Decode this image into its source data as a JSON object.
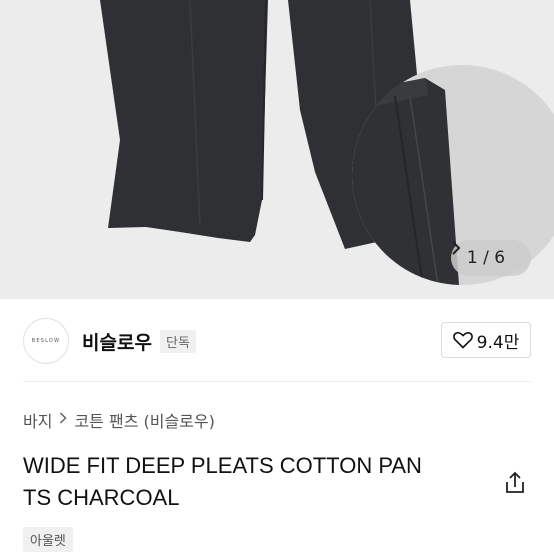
{
  "gallery": {
    "current": "1",
    "total": "6",
    "counter_text": "1 / 6",
    "next_icon": "chevron-right-icon"
  },
  "brand": {
    "logo_text": "BESLOW",
    "name": "비슬로우",
    "badge": "단독",
    "like_count": "9.4만",
    "like_icon": "heart-outline-icon"
  },
  "breadcrumb": {
    "category": "바지",
    "subcategory": "코튼 팬츠 (비슬로우)",
    "separator_icon": "chevron-right-icon"
  },
  "product": {
    "title_line1": "WIDE FIT DEEP PLEATS COTTON PAN",
    "title_line2": "TS CHARCOAL",
    "tag": "아울렛",
    "share_icon": "share-icon"
  },
  "colors": {
    "pants": "#2f3033",
    "hero_bg": "#ececec",
    "zoom_bg": "#d6d6d6"
  }
}
